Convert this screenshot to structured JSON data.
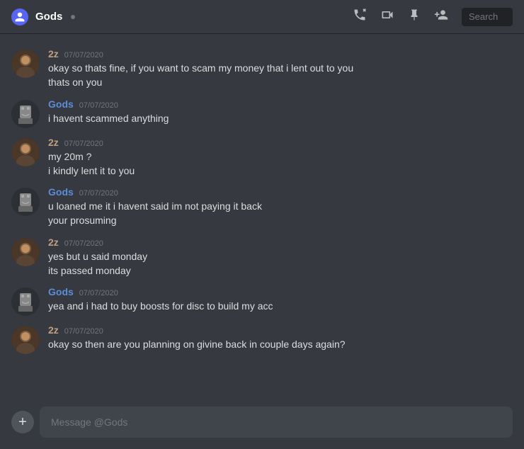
{
  "header": {
    "channel_name": "Gods",
    "search_placeholder": "Search"
  },
  "icons": {
    "phone": "📞",
    "video": "📹",
    "pin": "📌",
    "add_friend": "👤+"
  },
  "messages": [
    {
      "id": 1,
      "user": "2z",
      "user_type": "2z",
      "timestamp": "07/07/2020",
      "lines": [
        "okay so thats fine, if you want to scam my money that i lent out to you",
        "thats on you"
      ]
    },
    {
      "id": 2,
      "user": "Gods",
      "user_type": "gods",
      "timestamp": "07/07/2020",
      "lines": [
        "i havent scammed anything"
      ]
    },
    {
      "id": 3,
      "user": "2z",
      "user_type": "2z",
      "timestamp": "07/07/2020",
      "lines": [
        "my 20m ?",
        "i kindly lent it to you"
      ]
    },
    {
      "id": 4,
      "user": "Gods",
      "user_type": "gods",
      "timestamp": "07/07/2020",
      "lines": [
        "u loaned me it i havent said im not paying it back",
        "your prosuming"
      ]
    },
    {
      "id": 5,
      "user": "2z",
      "user_type": "2z",
      "timestamp": "07/07/2020",
      "lines": [
        "yes but u said monday",
        "its passed monday"
      ]
    },
    {
      "id": 6,
      "user": "Gods",
      "user_type": "gods",
      "timestamp": "07/07/2020",
      "lines": [
        "yea and i had to buy boosts for disc to build my acc"
      ]
    },
    {
      "id": 7,
      "user": "2z",
      "user_type": "2z",
      "timestamp": "07/07/2020",
      "lines": [
        "okay so then are you planning on givine back in couple days again?"
      ]
    }
  ],
  "input_placeholder": "Message @Gods"
}
